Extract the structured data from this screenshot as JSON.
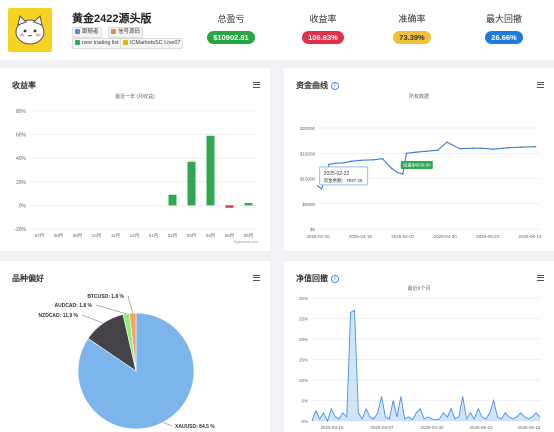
{
  "account": {
    "name": "黄金2422源头版",
    "tags": [
      {
        "label": "跟随者",
        "color": "#5a8dd6"
      },
      {
        "label": "信号源码",
        "color": "#e68a5a"
      },
      {
        "label": "new trading list",
        "color": "#3aa657"
      },
      {
        "label": "ICMarketsSC Live07",
        "color": "#e6b800"
      }
    ]
  },
  "stats": [
    {
      "label": "总盈亏",
      "value": "$10902.81",
      "color": "#26a641"
    },
    {
      "label": "收益率",
      "value": "106.83%",
      "color": "#e0334a"
    },
    {
      "label": "准确率",
      "value": "73.39%",
      "color": "#f2c037"
    },
    {
      "label": "最大回撤",
      "value": "26.66%",
      "color": "#1f7ae0"
    }
  ],
  "panels": {
    "returns": {
      "title": "收益率"
    },
    "equity": {
      "title": "资金曲线"
    },
    "symbols": {
      "title": "品种偏好"
    },
    "drawdown": {
      "title": "净值回撤"
    }
  },
  "chart_data": [
    {
      "type": "bar",
      "title": "收益率",
      "subtitle": "最近一年 (月收益)",
      "credit": "Highcharts.com",
      "categories": [
        "07月",
        "08月",
        "09月",
        "10月",
        "11月",
        "12月",
        "01月",
        "02月",
        "03月",
        "04月",
        "05月",
        "06月"
      ],
      "values": [
        0,
        0,
        0,
        0,
        0,
        0,
        0,
        9,
        37,
        59,
        -2,
        2
      ],
      "ylim": [
        -20,
        80
      ],
      "yticks": [
        "80%",
        "60%",
        "40%",
        "20%",
        "0%",
        "-20%"
      ],
      "colors": {
        "positive": "#2fa84f",
        "negative": "#e0334a"
      }
    },
    {
      "type": "line",
      "title": "资金曲线",
      "subtitle": "所有数据",
      "ylim": [
        0,
        20000
      ],
      "yticks": [
        "$20000",
        "$15000",
        "$10000",
        "$5000",
        "$0"
      ],
      "xticks": [
        "2025-02-20",
        "2025-03-15",
        "2025-04-07",
        "2025-04-30",
        "2025-05-23",
        "2025-06-15"
      ],
      "x": [
        "2025-02-20",
        "2025-02-22",
        "2025-02-26",
        "2025-03-01",
        "2025-03-06",
        "2025-03-10",
        "2025-03-15",
        "2025-03-22",
        "2025-03-27",
        "2025-04-01",
        "2025-04-04",
        "2025-04-07",
        "2025-04-09",
        "2025-04-14",
        "2025-04-20",
        "2025-04-26",
        "2025-05-01",
        "2025-05-08",
        "2025-05-15",
        "2025-05-20",
        "2025-05-26",
        "2025-06-03",
        "2025-06-10",
        "2025-06-18"
      ],
      "values": [
        8500,
        7937,
        12800,
        13000,
        13100,
        13400,
        13600,
        13700,
        13900,
        12000,
        11200,
        10900,
        15000,
        15200,
        15400,
        15600,
        17200,
        15900,
        16000,
        16000,
        15800,
        16100,
        16200,
        16300
      ],
      "tooltips": [
        {
          "date": "2025-02-22",
          "text": "资金余额：7937.26"
        },
        {
          "text": "出金$4630.90"
        }
      ],
      "color": "#3a7fd5"
    },
    {
      "type": "pie",
      "title": "品种偏好",
      "slices": [
        {
          "label": "XAUUSD: 84.5 %",
          "value": 84.5,
          "color": "#7cb5ec"
        },
        {
          "label": "NZDCAD: 11.9 %",
          "value": 11.9,
          "color": "#434348"
        },
        {
          "label": "AUDCAD: 1.8 %",
          "value": 1.8,
          "color": "#90ed7d"
        },
        {
          "label": "BTCUSD: 1.8 %",
          "value": 1.8,
          "color": "#f7a35c"
        }
      ]
    },
    {
      "type": "area",
      "title": "净值回撤",
      "subtitle": "最近6个月",
      "ylim": [
        0,
        30
      ],
      "yticks": [
        "30%",
        "25%",
        "20%",
        "15%",
        "10%",
        "5%",
        "0%"
      ],
      "xticks": [
        "2025-03-15",
        "2025-04-07",
        "2025-04-30",
        "2025-05-23",
        "2025-06-15"
      ],
      "values": [
        0,
        2.5,
        0.5,
        2,
        0,
        3,
        1,
        0.5,
        2,
        1,
        26.5,
        27,
        2,
        0.5,
        3,
        1,
        0.5,
        2,
        6,
        1,
        0.5,
        5,
        1,
        6,
        0.5,
        1,
        0.3,
        2,
        3,
        0.5,
        1,
        0.5,
        0.3,
        0.5,
        2,
        1,
        3,
        0.5,
        1,
        6,
        0.5,
        2,
        0.5,
        3,
        1,
        0.5,
        2,
        5,
        1,
        0.5,
        2,
        1,
        0.5,
        1,
        2,
        1,
        0.5,
        1,
        2,
        1
      ],
      "color": "#7cb5ec"
    }
  ]
}
